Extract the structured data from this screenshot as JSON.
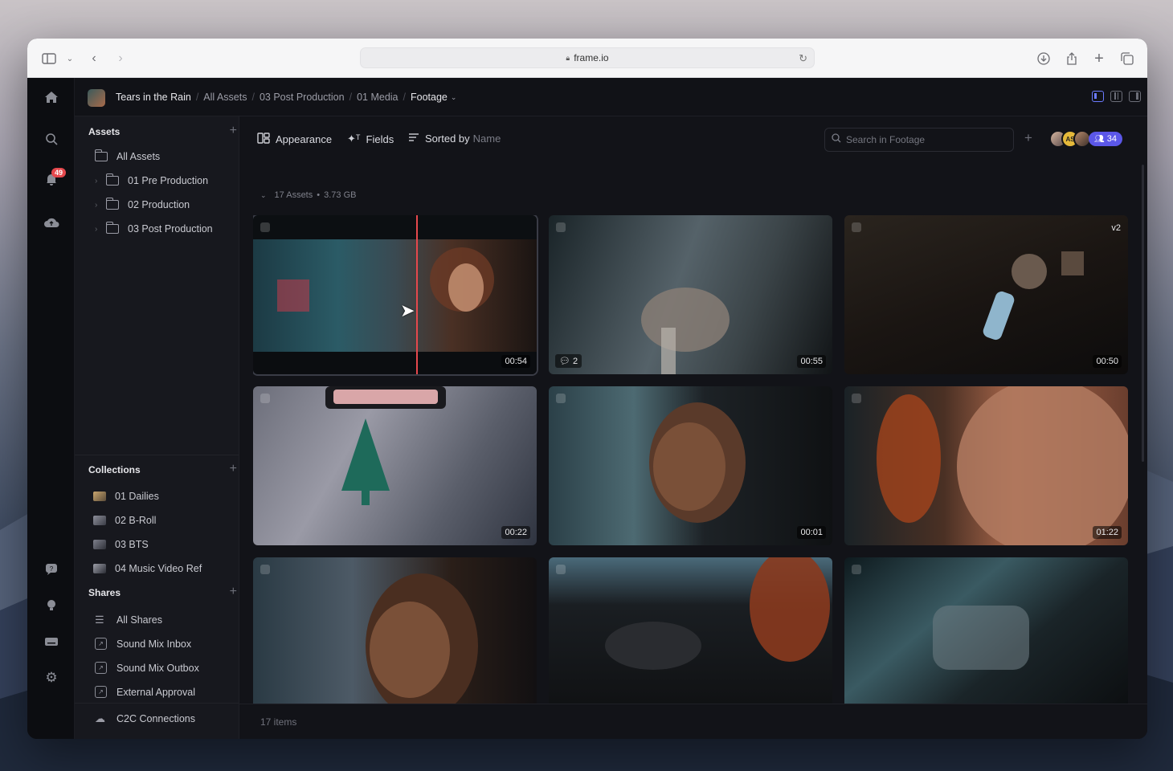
{
  "browser": {
    "url": "frame.io"
  },
  "rail": {
    "notification_count": "49",
    "logo_glyph": "R"
  },
  "breadcrumb": [
    "Tears in the Rain",
    "All Assets",
    "03 Post Production",
    "01 Media",
    "Footage"
  ],
  "sidebar": {
    "assets_title": "Assets",
    "assets_items": [
      {
        "label": "All Assets",
        "expandable": false
      },
      {
        "label": "01 Pre Production",
        "expandable": true
      },
      {
        "label": "02 Production",
        "expandable": true
      },
      {
        "label": "03 Post Production",
        "expandable": true
      }
    ],
    "collections_title": "Collections",
    "collections": [
      "01 Dailies",
      "02 B-Roll",
      "03 BTS",
      "04 Music Video Ref"
    ],
    "shares_title": "Shares",
    "shares": [
      "All Shares",
      "Sound Mix Inbox",
      "Sound Mix Outbox",
      "External Approval",
      "C2C Connections"
    ]
  },
  "toolbar": {
    "appearance": "Appearance",
    "fields": "Fields",
    "sorted_by": "Sorted by",
    "sort_field": "Name",
    "search_placeholder": "Search in Footage",
    "avatar_initials": "AS",
    "member_count": "34"
  },
  "group": {
    "count_label": "17 Assets",
    "size": "3.73 GB"
  },
  "assets": [
    {
      "duration": "00:54",
      "selected": true,
      "scrub": true
    },
    {
      "duration": "00:55",
      "comments": "2"
    },
    {
      "duration": "00:50",
      "version": "v2"
    },
    {
      "duration": "00:22"
    },
    {
      "duration": "00:01"
    },
    {
      "duration": "01:22"
    },
    {
      "duration": ""
    },
    {
      "duration": ""
    },
    {
      "duration": ""
    }
  ],
  "footer": {
    "items_label": "17 items"
  },
  "colors": {
    "accent": "#5b57e8",
    "badge": "#e5484d",
    "background": "#121318"
  }
}
